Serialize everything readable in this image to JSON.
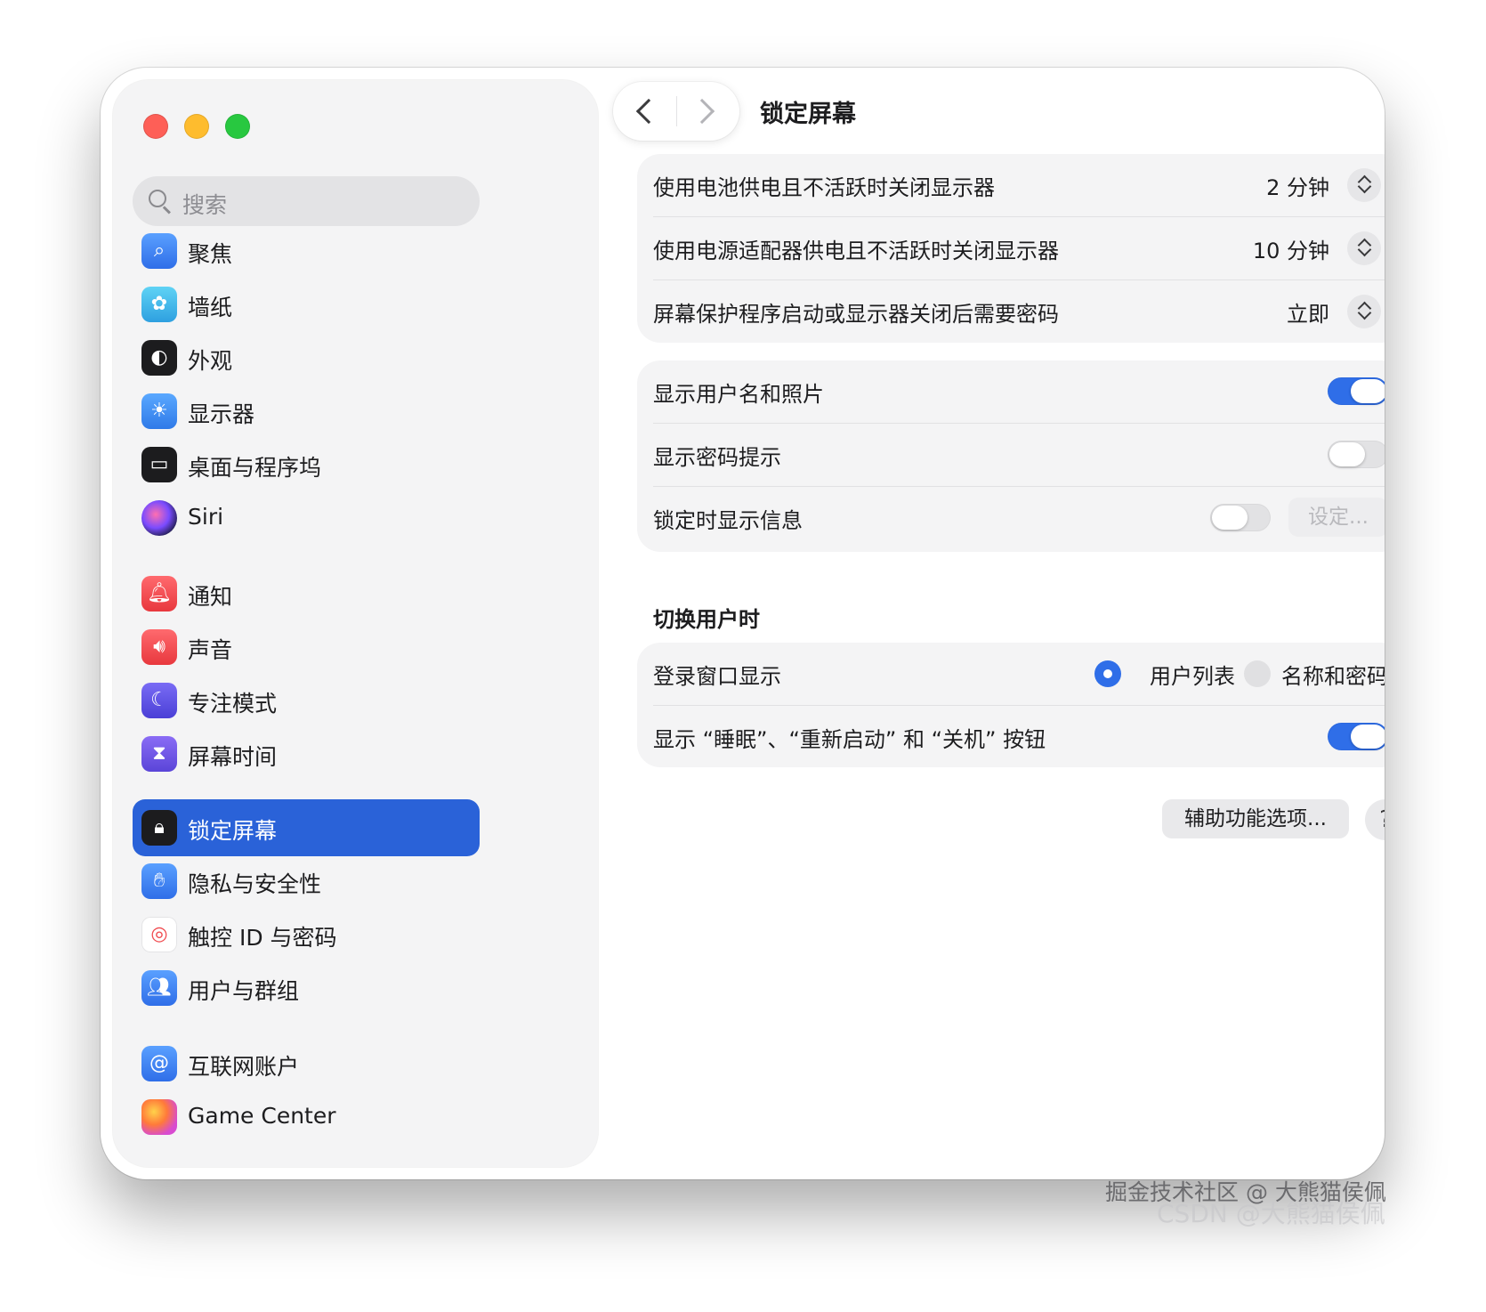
{
  "window": {
    "title": "锁定屏幕"
  },
  "search": {
    "placeholder": "搜索"
  },
  "sidebar": {
    "items": [
      {
        "label": "聚焦",
        "icon": "spotlight-icon",
        "color": "#3b82f6"
      },
      {
        "label": "墙纸",
        "icon": "wallpaper-icon",
        "color": "#35b6e8"
      },
      {
        "label": "外观",
        "icon": "appearance-icon",
        "color": "#1c1c1e"
      },
      {
        "label": "显示器",
        "icon": "displays-icon",
        "color": "#3b8df5"
      },
      {
        "label": "桌面与程序坞",
        "icon": "desktop-dock-icon",
        "color": "#1c1c1e"
      },
      {
        "label": "Siri",
        "icon": "siri-icon",
        "color": "#6a3fd1"
      },
      {
        "label": "通知",
        "icon": "notifications-icon",
        "color": "#f0494e"
      },
      {
        "label": "声音",
        "icon": "sound-icon",
        "color": "#f0494e"
      },
      {
        "label": "专注模式",
        "icon": "focus-icon",
        "color": "#5b4fe0"
      },
      {
        "label": "屏幕时间",
        "icon": "screen-time-icon",
        "color": "#6e55e0"
      },
      {
        "label": "锁定屏幕",
        "icon": "lock-screen-icon",
        "color": "#1c1c1e"
      },
      {
        "label": "隐私与安全性",
        "icon": "privacy-hand-icon",
        "color": "#3b82f6"
      },
      {
        "label": "触控 ID 与密码",
        "icon": "touch-id-icon",
        "color": "#ffffff"
      },
      {
        "label": "用户与群组",
        "icon": "users-groups-icon",
        "color": "#3b82f6"
      },
      {
        "label": "互联网账户",
        "icon": "internet-accounts-icon",
        "color": "#3b82f6"
      },
      {
        "label": "Game Center",
        "icon": "game-center-icon",
        "color": "#f57b3f"
      }
    ]
  },
  "display_group": {
    "rows": [
      {
        "label": "使用电池供电且不活跃时关闭显示器",
        "value": "2 分钟"
      },
      {
        "label": "使用电源适配器供电且不活跃时关闭显示器",
        "value": "10 分钟"
      },
      {
        "label": "屏幕保护程序启动或显示器关闭后需要密码",
        "value": "立即"
      }
    ]
  },
  "info_group": {
    "show_user": {
      "label": "显示用户名和照片",
      "on": true
    },
    "password_hint": {
      "label": "显示密码提示",
      "on": false
    },
    "lock_message": {
      "label": "锁定时显示信息",
      "on": false,
      "button": "设定..."
    }
  },
  "switch_users": {
    "heading": "切换用户时",
    "login_window": {
      "label": "登录窗口显示",
      "option_list": "用户列表",
      "option_name": "名称和密码",
      "selected": "用户列表"
    },
    "buttons_row": {
      "label": "显示 “睡眠”、“重新启动” 和 “关机” 按钮",
      "on": true
    }
  },
  "footer": {
    "accessibility_button": "辅助功能选项...",
    "help": "?"
  },
  "watermark": {
    "line1": "掘金技术社区 @ 大熊猫侯佩",
    "line2": "CSDN @大熊猫侯佩"
  }
}
